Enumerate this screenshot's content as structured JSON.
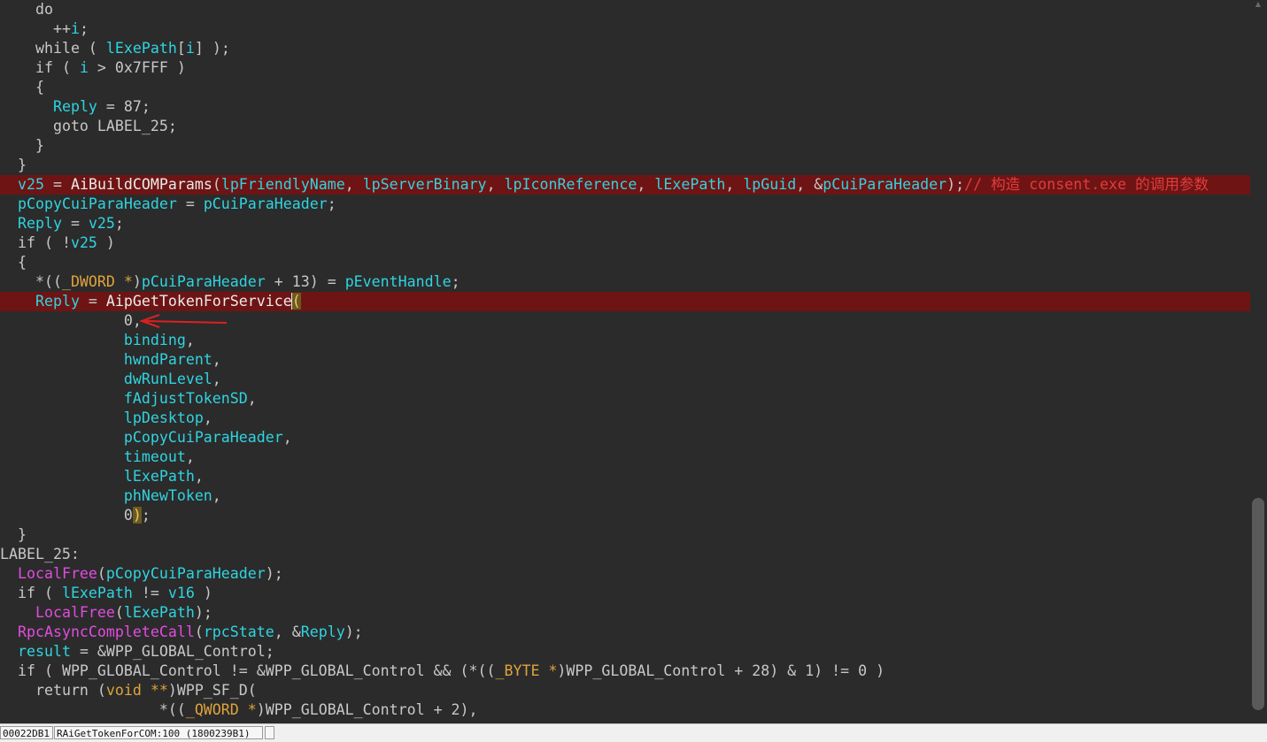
{
  "colors": {
    "background": "#2b2b2b",
    "highlight_line": "#6e1414",
    "variable": "#2fd4e0",
    "import_func": "#e14ce0",
    "type": "#e0a33b",
    "comment": "#e23c3c",
    "default_text": "#c8c8c8"
  },
  "code_lines": [
    {
      "hl": false,
      "tokens": [
        {
          "t": "  do",
          "c": "kw"
        }
      ]
    },
    {
      "hl": false,
      "tokens": [
        {
          "t": "    ++",
          "c": "op"
        },
        {
          "t": "i",
          "c": "var"
        },
        {
          "t": ";",
          "c": "op"
        }
      ]
    },
    {
      "hl": false,
      "tokens": [
        {
          "t": "  while ( ",
          "c": "kw"
        },
        {
          "t": "lExePath",
          "c": "var"
        },
        {
          "t": "[",
          "c": "op"
        },
        {
          "t": "i",
          "c": "var"
        },
        {
          "t": "] );",
          "c": "op"
        }
      ]
    },
    {
      "hl": false,
      "tokens": [
        {
          "t": "  if ( ",
          "c": "kw"
        },
        {
          "t": "i",
          "c": "var"
        },
        {
          "t": " > 0x7FFF )",
          "c": "op"
        }
      ]
    },
    {
      "hl": false,
      "tokens": [
        {
          "t": "  {",
          "c": "op"
        }
      ]
    },
    {
      "hl": false,
      "tokens": [
        {
          "t": "    ",
          "c": "op"
        },
        {
          "t": "Reply",
          "c": "var"
        },
        {
          "t": " = 87;",
          "c": "op"
        }
      ]
    },
    {
      "hl": false,
      "tokens": [
        {
          "t": "    goto LABEL_25;",
          "c": "kw"
        }
      ]
    },
    {
      "hl": false,
      "tokens": [
        {
          "t": "  }",
          "c": "op"
        }
      ]
    },
    {
      "hl": false,
      "tokens": [
        {
          "t": "}",
          "c": "op"
        }
      ]
    },
    {
      "hl": true,
      "tokens": [
        {
          "t": "v25",
          "c": "var"
        },
        {
          "t": " = ",
          "c": "op"
        },
        {
          "t": "AiBuildCOMParams",
          "c": "func"
        },
        {
          "t": "(",
          "c": "op"
        },
        {
          "t": "lpFriendlyName",
          "c": "var"
        },
        {
          "t": ", ",
          "c": "op"
        },
        {
          "t": "lpServerBinary",
          "c": "var"
        },
        {
          "t": ", ",
          "c": "op"
        },
        {
          "t": "lpIconReference",
          "c": "var"
        },
        {
          "t": ", ",
          "c": "op"
        },
        {
          "t": "lExePath",
          "c": "var"
        },
        {
          "t": ", ",
          "c": "op"
        },
        {
          "t": "lpGuid",
          "c": "var"
        },
        {
          "t": ", &",
          "c": "op"
        },
        {
          "t": "pCuiParaHeader",
          "c": "var"
        },
        {
          "t": ");",
          "c": "op"
        },
        {
          "t": "// 构造 consent.exe 的调用参数",
          "c": "cmt"
        }
      ]
    },
    {
      "hl": false,
      "tokens": [
        {
          "t": "pCopyCuiParaHeader",
          "c": "var"
        },
        {
          "t": " = ",
          "c": "op"
        },
        {
          "t": "pCuiParaHeader",
          "c": "var"
        },
        {
          "t": ";",
          "c": "op"
        }
      ]
    },
    {
      "hl": false,
      "tokens": [
        {
          "t": "Reply",
          "c": "var"
        },
        {
          "t": " = ",
          "c": "op"
        },
        {
          "t": "v25",
          "c": "var"
        },
        {
          "t": ";",
          "c": "op"
        }
      ]
    },
    {
      "hl": false,
      "tokens": [
        {
          "t": "if ( !",
          "c": "kw"
        },
        {
          "t": "v25",
          "c": "var"
        },
        {
          "t": " )",
          "c": "op"
        }
      ]
    },
    {
      "hl": false,
      "tokens": [
        {
          "t": "{",
          "c": "op"
        }
      ]
    },
    {
      "hl": false,
      "tokens": [
        {
          "t": "  *((",
          "c": "op"
        },
        {
          "t": "_DWORD *",
          "c": "type"
        },
        {
          "t": ")",
          "c": "op"
        },
        {
          "t": "pCuiParaHeader",
          "c": "var"
        },
        {
          "t": " + 13) = ",
          "c": "op"
        },
        {
          "t": "pEventHandle",
          "c": "var"
        },
        {
          "t": ";",
          "c": "op"
        }
      ]
    },
    {
      "hl": true,
      "tokens": [
        {
          "t": "  ",
          "c": "op"
        },
        {
          "t": "Reply",
          "c": "var"
        },
        {
          "t": " = ",
          "c": "op"
        },
        {
          "t": "AipGetTokenForService",
          "c": "func"
        },
        {
          "t": "CARET",
          "c": "caret"
        },
        {
          "t": "(",
          "c": "brace"
        }
      ]
    },
    {
      "hl": false,
      "tokens": [
        {
          "t": "            0,",
          "c": "num"
        }
      ]
    },
    {
      "hl": false,
      "tokens": [
        {
          "t": "            ",
          "c": "op"
        },
        {
          "t": "binding",
          "c": "var"
        },
        {
          "t": ",",
          "c": "op"
        }
      ]
    },
    {
      "hl": false,
      "tokens": [
        {
          "t": "            ",
          "c": "op"
        },
        {
          "t": "hwndParent",
          "c": "var"
        },
        {
          "t": ",",
          "c": "op"
        }
      ]
    },
    {
      "hl": false,
      "tokens": [
        {
          "t": "            ",
          "c": "op"
        },
        {
          "t": "dwRunLevel",
          "c": "var"
        },
        {
          "t": ",",
          "c": "op"
        }
      ]
    },
    {
      "hl": false,
      "tokens": [
        {
          "t": "            ",
          "c": "op"
        },
        {
          "t": "fAdjustTokenSD",
          "c": "var"
        },
        {
          "t": ",",
          "c": "op"
        }
      ]
    },
    {
      "hl": false,
      "tokens": [
        {
          "t": "            ",
          "c": "op"
        },
        {
          "t": "lpDesktop",
          "c": "var"
        },
        {
          "t": ",",
          "c": "op"
        }
      ]
    },
    {
      "hl": false,
      "tokens": [
        {
          "t": "            ",
          "c": "op"
        },
        {
          "t": "pCopyCuiParaHeader",
          "c": "var"
        },
        {
          "t": ",",
          "c": "op"
        }
      ]
    },
    {
      "hl": false,
      "tokens": [
        {
          "t": "            ",
          "c": "op"
        },
        {
          "t": "timeout",
          "c": "var"
        },
        {
          "t": ",",
          "c": "op"
        }
      ]
    },
    {
      "hl": false,
      "tokens": [
        {
          "t": "            ",
          "c": "op"
        },
        {
          "t": "lExePath",
          "c": "var"
        },
        {
          "t": ",",
          "c": "op"
        }
      ]
    },
    {
      "hl": false,
      "tokens": [
        {
          "t": "            ",
          "c": "op"
        },
        {
          "t": "phNewToken",
          "c": "var"
        },
        {
          "t": ",",
          "c": "op"
        }
      ]
    },
    {
      "hl": false,
      "tokens": [
        {
          "t": "            0",
          "c": "num"
        },
        {
          "t": ")",
          "c": "brace"
        },
        {
          "t": ";",
          "c": "op"
        }
      ]
    },
    {
      "hl": false,
      "tokens": [
        {
          "t": "}",
          "c": "op"
        }
      ]
    },
    {
      "hl": false,
      "tokens": [
        {
          "t": "LABEL_25:",
          "c": "label",
          "outdent": true
        }
      ]
    },
    {
      "hl": false,
      "tokens": [
        {
          "t": "LocalFree",
          "c": "import"
        },
        {
          "t": "(",
          "c": "op"
        },
        {
          "t": "pCopyCuiParaHeader",
          "c": "var"
        },
        {
          "t": ");",
          "c": "op"
        }
      ]
    },
    {
      "hl": false,
      "tokens": [
        {
          "t": "if ( ",
          "c": "kw"
        },
        {
          "t": "lExePath",
          "c": "var"
        },
        {
          "t": " != ",
          "c": "op"
        },
        {
          "t": "v16",
          "c": "var"
        },
        {
          "t": " )",
          "c": "op"
        }
      ]
    },
    {
      "hl": false,
      "tokens": [
        {
          "t": "  ",
          "c": "op"
        },
        {
          "t": "LocalFree",
          "c": "import"
        },
        {
          "t": "(",
          "c": "op"
        },
        {
          "t": "lExePath",
          "c": "var"
        },
        {
          "t": ");",
          "c": "op"
        }
      ]
    },
    {
      "hl": false,
      "tokens": [
        {
          "t": "RpcAsyncCompleteCall",
          "c": "import"
        },
        {
          "t": "(",
          "c": "op"
        },
        {
          "t": "rpcState",
          "c": "var"
        },
        {
          "t": ", &",
          "c": "op"
        },
        {
          "t": "Reply",
          "c": "var"
        },
        {
          "t": ");",
          "c": "op"
        }
      ]
    },
    {
      "hl": false,
      "tokens": [
        {
          "t": "result",
          "c": "var"
        },
        {
          "t": " = &WPP_GLOBAL_Control;",
          "c": "op"
        }
      ]
    },
    {
      "hl": false,
      "tokens": [
        {
          "t": "if ( WPP_GLOBAL_Control != &WPP_GLOBAL_Control && (*((",
          "c": "kw"
        },
        {
          "t": "_BYTE *",
          "c": "type"
        },
        {
          "t": ")WPP_GLOBAL_Control + 28) & 1) != 0 )",
          "c": "op"
        }
      ]
    },
    {
      "hl": false,
      "tokens": [
        {
          "t": "  return (",
          "c": "kw"
        },
        {
          "t": "void **",
          "c": "type"
        },
        {
          "t": ")WPP_SF_D(",
          "c": "op"
        }
      ]
    },
    {
      "hl": false,
      "tokens": [
        {
          "t": "                *((",
          "c": "op"
        },
        {
          "t": "_QWORD *",
          "c": "type"
        },
        {
          "t": ")WPP_GLOBAL_Control + 2),",
          "c": "op"
        }
      ]
    },
    {
      "hl": false,
      "tokens": [
        {
          "t": "                ",
          "c": "op"
        }
      ]
    }
  ],
  "status": {
    "address": "00022DB1",
    "location": "RAiGetTokenForCOM:100 (1800239B1)",
    "extra": ""
  }
}
